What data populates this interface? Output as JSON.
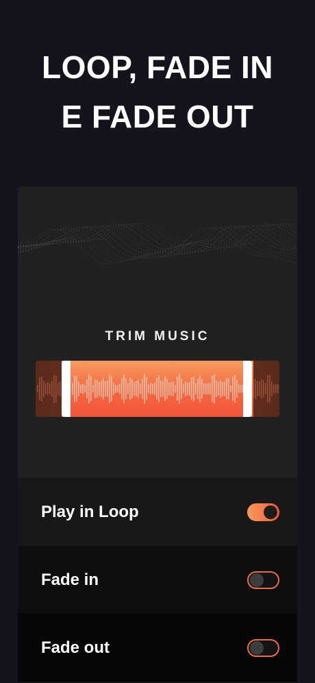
{
  "headline": {
    "line1": "LOOP, FADE IN",
    "line2": "E FADE OUT"
  },
  "card": {
    "trim_title": "TRIM MUSIC",
    "trimmer": {
      "selection_start": 0.11,
      "selection_end": 0.89
    }
  },
  "settings": [
    {
      "label": "Play in Loop",
      "enabled": true
    },
    {
      "label": "Fade in",
      "enabled": false
    },
    {
      "label": "Fade out",
      "enabled": false
    }
  ],
  "colors": {
    "accent": "#f4683e",
    "background": "#14141c",
    "card": "#212121"
  }
}
